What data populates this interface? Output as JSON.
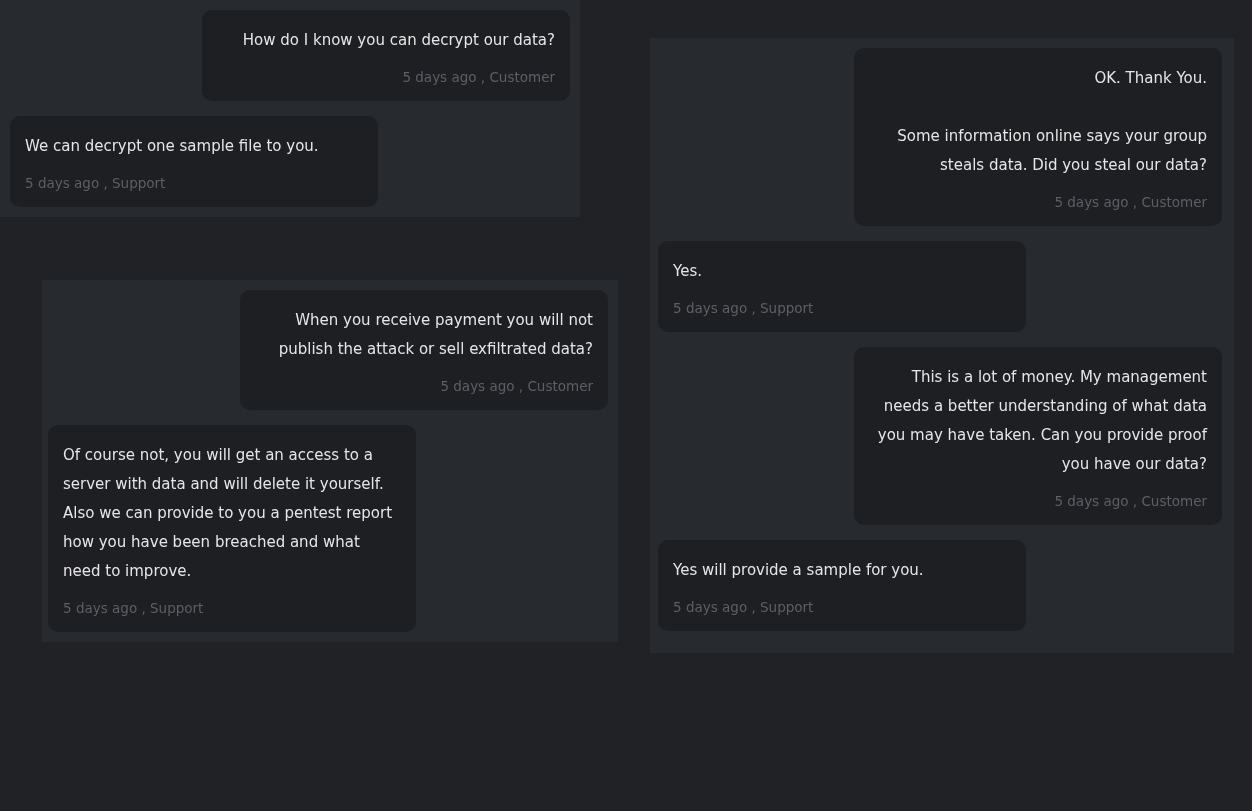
{
  "panels": [
    {
      "messages": [
        {
          "kind": "customer",
          "text": "How do I know you can decrypt our data?",
          "meta": "5 days ago , Customer"
        },
        {
          "kind": "support",
          "text": "We can decrypt one sample file to you.",
          "meta": "5 days ago , Support"
        }
      ]
    },
    {
      "messages": [
        {
          "kind": "customer",
          "text": "When you receive payment you will not publish the attack or sell exfiltrated data?",
          "meta": "5 days ago , Customer"
        },
        {
          "kind": "support",
          "text": "Of course not, you will get an access to a server with data and will delete it yourself. Also we can provide to you a pentest report how you have been breached and what need to improve.",
          "meta": "5 days ago , Support"
        }
      ]
    },
    {
      "messages": [
        {
          "kind": "customer",
          "text": "OK. Thank You.\n\nSome information online says your group steals data. Did you steal our data?",
          "meta": "5 days ago , Customer"
        },
        {
          "kind": "support",
          "text": "Yes.",
          "meta": "5 days ago , Support"
        },
        {
          "kind": "customer",
          "text": "This is a lot of money. My management needs a better understanding of what data you may have taken. Can you provide proof you have our data?",
          "meta": "5 days ago , Customer"
        },
        {
          "kind": "support",
          "text": "Yes will provide a sample for you.",
          "meta": "5 days ago , Support"
        }
      ]
    }
  ]
}
